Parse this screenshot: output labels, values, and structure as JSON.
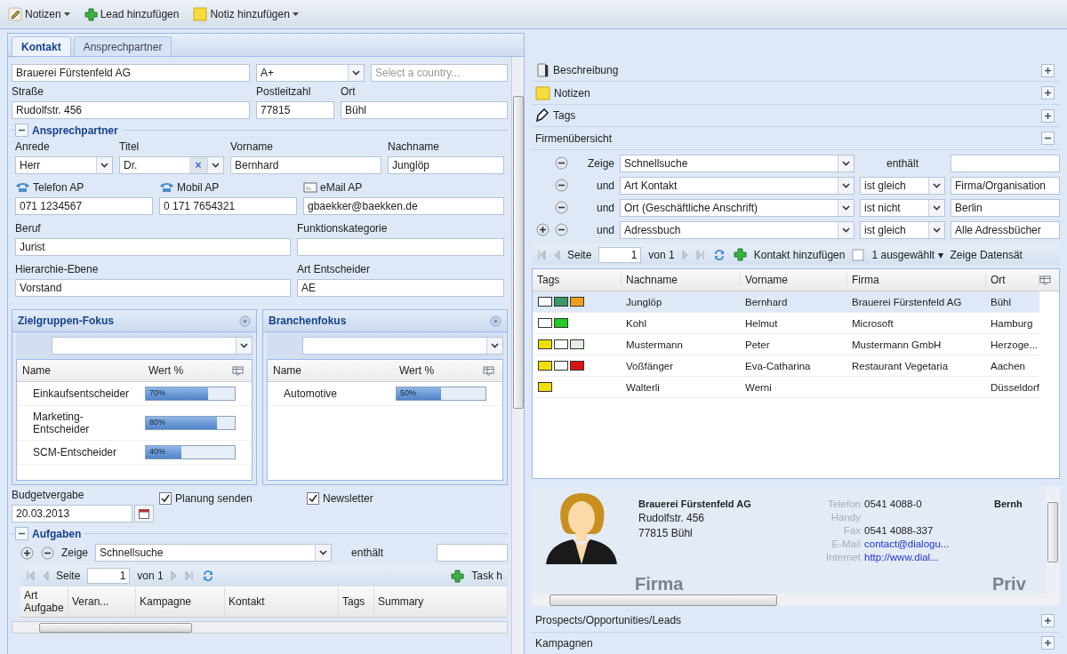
{
  "toolbar": [
    {
      "kind": "edit",
      "label": "Notizen",
      "dropdown": true
    },
    {
      "kind": "add",
      "label": "Lead hinzufügen",
      "dropdown": false
    },
    {
      "kind": "note",
      "label": "Notiz hinzufügen",
      "dropdown": true
    }
  ],
  "tabs": [
    {
      "label": "Kontakt",
      "selected": true
    },
    {
      "label": "Ansprechpartner",
      "selected": false
    }
  ],
  "company": {
    "name": "Brauerei Fürstenfeld AG",
    "rating": "A+",
    "country_placeholder": "Select a country...",
    "street_label": "Straße",
    "street": "Rudolfstr. 456",
    "zip_label": "Postleitzahl",
    "zip": "77815",
    "city_label": "Ort",
    "city": "Bühl"
  },
  "contact_person": {
    "title": "Ansprechpartner",
    "expanded": true,
    "fields": [
      {
        "kind": "select",
        "label": "Anrede",
        "value": "Herr"
      },
      {
        "kind": "clearable",
        "label": "Titel",
        "value": "Dr.",
        "clear_symbol": "×"
      },
      {
        "kind": "text",
        "label": "Vorname",
        "value": "Bernhard"
      },
      {
        "kind": "text",
        "label": "Nachname",
        "value": "Junglöp"
      },
      {
        "kind": "phone",
        "label": "Telefon AP",
        "value": "071 1234567"
      },
      {
        "kind": "phone",
        "label": "Mobil AP",
        "value": "0 171 7654321"
      },
      {
        "kind": "mail",
        "label": "eMail AP",
        "value": "gbaekker@baekken.de"
      },
      {
        "kind": "text",
        "label": "Beruf",
        "value": "Jurist"
      },
      {
        "kind": "text",
        "label": "Funktionskategorie"
      },
      {
        "kind": "text",
        "label": "Hierarchie-Ebene",
        "value": "Vorstand"
      },
      {
        "kind": "text",
        "label": "Art Entscheider",
        "value": "AE"
      }
    ]
  },
  "focus_panels": [
    {
      "title": "Zielgruppen-Fokus",
      "columns": [
        "Name",
        "Wert %"
      ],
      "rows": [
        {
          "name": "Einkaufsentscheider",
          "level": 0.7,
          "reading": "70%"
        },
        {
          "name": "Marketing-Entscheider",
          "level": 0.8,
          "reading": "80%"
        },
        {
          "name": "SCM-Entscheider",
          "level": 0.4,
          "reading": "40%"
        }
      ]
    },
    {
      "title": "Branchenfokus",
      "columns": [
        "Name",
        "Wert %"
      ],
      "rows": [
        {
          "name": "Automotive",
          "level": 0.5,
          "reading": "50%"
        }
      ]
    }
  ],
  "budget": {
    "label": "Budgetvergabe",
    "value": "20.03.2013",
    "checkboxes": [
      {
        "label": "Planung senden",
        "checked": true
      },
      {
        "label": "Newsletter",
        "checked": true
      }
    ]
  },
  "tasks": {
    "title": "Aufgaben",
    "expanded": true,
    "filter_label": "Zeige",
    "filter_field": "Schnellsuche",
    "filter_op": "enthält",
    "page_label": "Seite",
    "page": "1",
    "page_of": "von 1",
    "add_label": "Task h",
    "columns": [
      "Art Aufgabe",
      "Veran...",
      "Kampagne",
      "Kontakt",
      "Tags",
      "Summary"
    ]
  },
  "accordion": [
    {
      "kind": "description",
      "title": "Beschreibung",
      "expanded": false
    },
    {
      "kind": "notes",
      "title": "Notizen",
      "expanded": false
    },
    {
      "kind": "tags",
      "title": "Tags",
      "expanded": false
    },
    {
      "kind": "plain",
      "title": "Firmenübersicht",
      "expanded": true
    }
  ],
  "filters": [
    {
      "kind": "contains",
      "can_add": false,
      "conjunction": "Zeige",
      "field": "Schnellsuche",
      "operator": "enthält"
    },
    {
      "kind": "compare",
      "can_add": false,
      "conjunction": "und",
      "field": "Art Kontakt",
      "operator": "ist gleich",
      "value": "Firma/Organisation"
    },
    {
      "kind": "compare",
      "can_add": false,
      "conjunction": "und",
      "field": "Ort  (Geschäftliche Anschrift)",
      "operator": "ist nicht",
      "value": "Berlin"
    },
    {
      "kind": "compare",
      "can_add": true,
      "conjunction": "und",
      "field": "Adressbuch",
      "operator": "ist gleich",
      "value": "Alle Adressbücher"
    }
  ],
  "contacts": {
    "page_label": "Seite",
    "page": "1",
    "page_of": "von 1",
    "add_label": "Kontakt hinzufügen",
    "selection": "1 ausgewählt",
    "selection_caret": "▾",
    "show_label": "Zeige Datensät",
    "columns": [
      "Tags",
      "Nachname",
      "Vorname",
      "Firma",
      "Ort"
    ],
    "rows": [
      {
        "selected": true,
        "tags": [
          {
            "color": "#ffffff"
          },
          {
            "color": "#3a9a6a"
          },
          {
            "color": "#f0a020"
          }
        ],
        "last_name": "Junglöp",
        "first_name": "Bernhard",
        "company": "Brauerei Fürstenfeld AG",
        "city": "Bühl"
      },
      {
        "selected": false,
        "tags": [
          {
            "color": "#ffffff"
          },
          {
            "color": "#22cc22"
          }
        ],
        "last_name": "Kohl",
        "first_name": "Helmut",
        "company": "Microsoft",
        "city": "Hamburg"
      },
      {
        "selected": false,
        "tags": [
          {
            "color": "#f0e000"
          },
          {
            "color": "#ffffff"
          },
          {
            "color": "#e0f0e0"
          }
        ],
        "last_name": "Mustermann",
        "first_name": "Peter",
        "company": "Mustermann GmbH",
        "city": "Herzoge..."
      },
      {
        "selected": false,
        "tags": [
          {
            "color": "#f0e000"
          },
          {
            "color": "#ffffff"
          },
          {
            "color": "#dd1111"
          }
        ],
        "last_name": "Voßfänger",
        "first_name": "Eva-Catharina",
        "company": "Restaurant Vegetaria",
        "city": "Aachen"
      },
      {
        "selected": false,
        "tags": [
          {
            "color": "#f0e000"
          }
        ],
        "last_name": "Walterli",
        "first_name": "Werni",
        "city": "Düsseldorf"
      }
    ]
  },
  "card": {
    "company": "Brauerei Fürstenfeld AG",
    "street": "Rudolfstr. 456",
    "city": "77815 Bühl",
    "details": [
      {
        "kind": "text",
        "label": "Telefon",
        "value": "0541 4088-0"
      },
      {
        "kind": "text",
        "label": "Handy"
      },
      {
        "kind": "text",
        "label": "Fax",
        "value": "0541 4088-337"
      },
      {
        "kind": "link",
        "label": "E-Mail",
        "value": "contact@dialogu..."
      },
      {
        "kind": "link",
        "label": "Internet",
        "value": "http://www.dial..."
      }
    ],
    "section_label": "Firma",
    "second_label": "Priv",
    "second_name": "Bernh"
  },
  "bottom_sections": [
    {
      "title": "Prospects/Opportunities/Leads",
      "expanded": false
    },
    {
      "title": "Kampagnen",
      "expanded": false
    }
  ]
}
